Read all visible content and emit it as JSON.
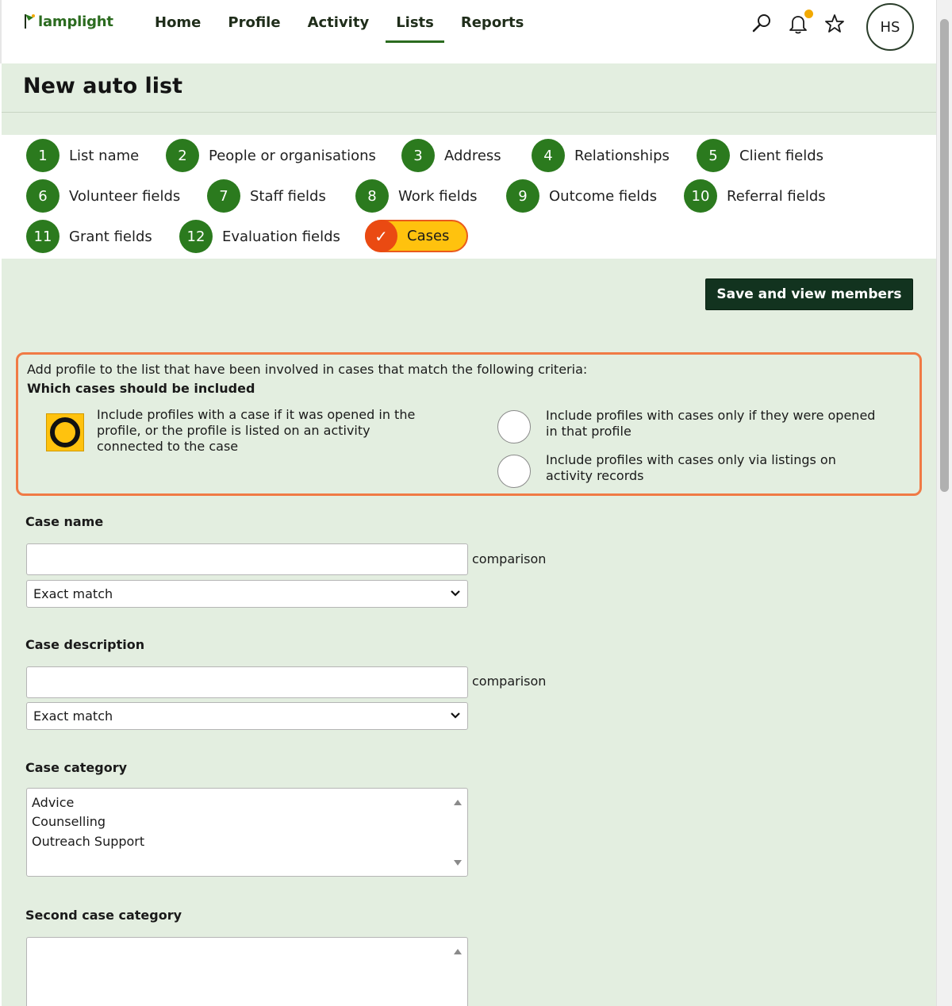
{
  "app": {
    "logo_text": "lamplight"
  },
  "nav": {
    "items": [
      {
        "label": "Home"
      },
      {
        "label": "Profile"
      },
      {
        "label": "Activity"
      },
      {
        "label": "Lists"
      },
      {
        "label": "Reports"
      }
    ],
    "active": "Lists"
  },
  "top_icons": {
    "search": "search-icon",
    "notifications": "bell-icon",
    "favourites": "star-icon",
    "avatar_initials": "HS",
    "notification_dot_color": "#f2a900"
  },
  "page": {
    "title": "New auto list"
  },
  "steps": [
    {
      "num": "1",
      "label": "List name"
    },
    {
      "num": "2",
      "label": "People or organisations"
    },
    {
      "num": "3",
      "label": "Address"
    },
    {
      "num": "4",
      "label": "Relationships"
    },
    {
      "num": "5",
      "label": "Client fields"
    },
    {
      "num": "6",
      "label": "Volunteer fields"
    },
    {
      "num": "7",
      "label": "Staff fields"
    },
    {
      "num": "8",
      "label": "Work fields"
    },
    {
      "num": "9",
      "label": "Outcome fields"
    },
    {
      "num": "10",
      "label": "Referral fields"
    },
    {
      "num": "11",
      "label": "Grant fields"
    },
    {
      "num": "12",
      "label": "Evaluation fields"
    }
  ],
  "current_step": {
    "check": "✓",
    "label": "Cases"
  },
  "actions": {
    "save_label": "Save and view members"
  },
  "criteria": {
    "intro": "Add profile to the list that have been involved in cases that match the following criteria:",
    "heading": "Which cases should be included",
    "options": [
      {
        "label_lines": [
          "Include profiles with a case if it was opened in the",
          "profile, or the profile is listed on an activity",
          "connected to the case"
        ],
        "selected": true
      },
      {
        "label_lines": [
          "Include profiles with cases only if they were opened",
          "in that profile"
        ],
        "selected": false
      },
      {
        "label_lines": [
          "Include profiles with cases only via listings on",
          "activity records"
        ],
        "selected": false
      }
    ]
  },
  "fields": {
    "case_name": {
      "label": "Case name",
      "value": "",
      "comparison_label": "comparison",
      "select_value": "Exact match"
    },
    "case_description": {
      "label": "Case description",
      "value": "",
      "comparison_label": "comparison",
      "select_value": "Exact match"
    },
    "case_category": {
      "label": "Case category",
      "options": [
        "Advice",
        "Counselling",
        "Outreach Support"
      ]
    },
    "second_case_category": {
      "label": "Second case category",
      "options": []
    }
  },
  "colors": {
    "brand_green": "#2b7a1e",
    "band_green": "#e3eee0",
    "current_step_fill": "#ffc20e",
    "current_step_accent": "#ea4a12",
    "highlight_border": "#f07a45",
    "button_dark": "#12331f"
  }
}
